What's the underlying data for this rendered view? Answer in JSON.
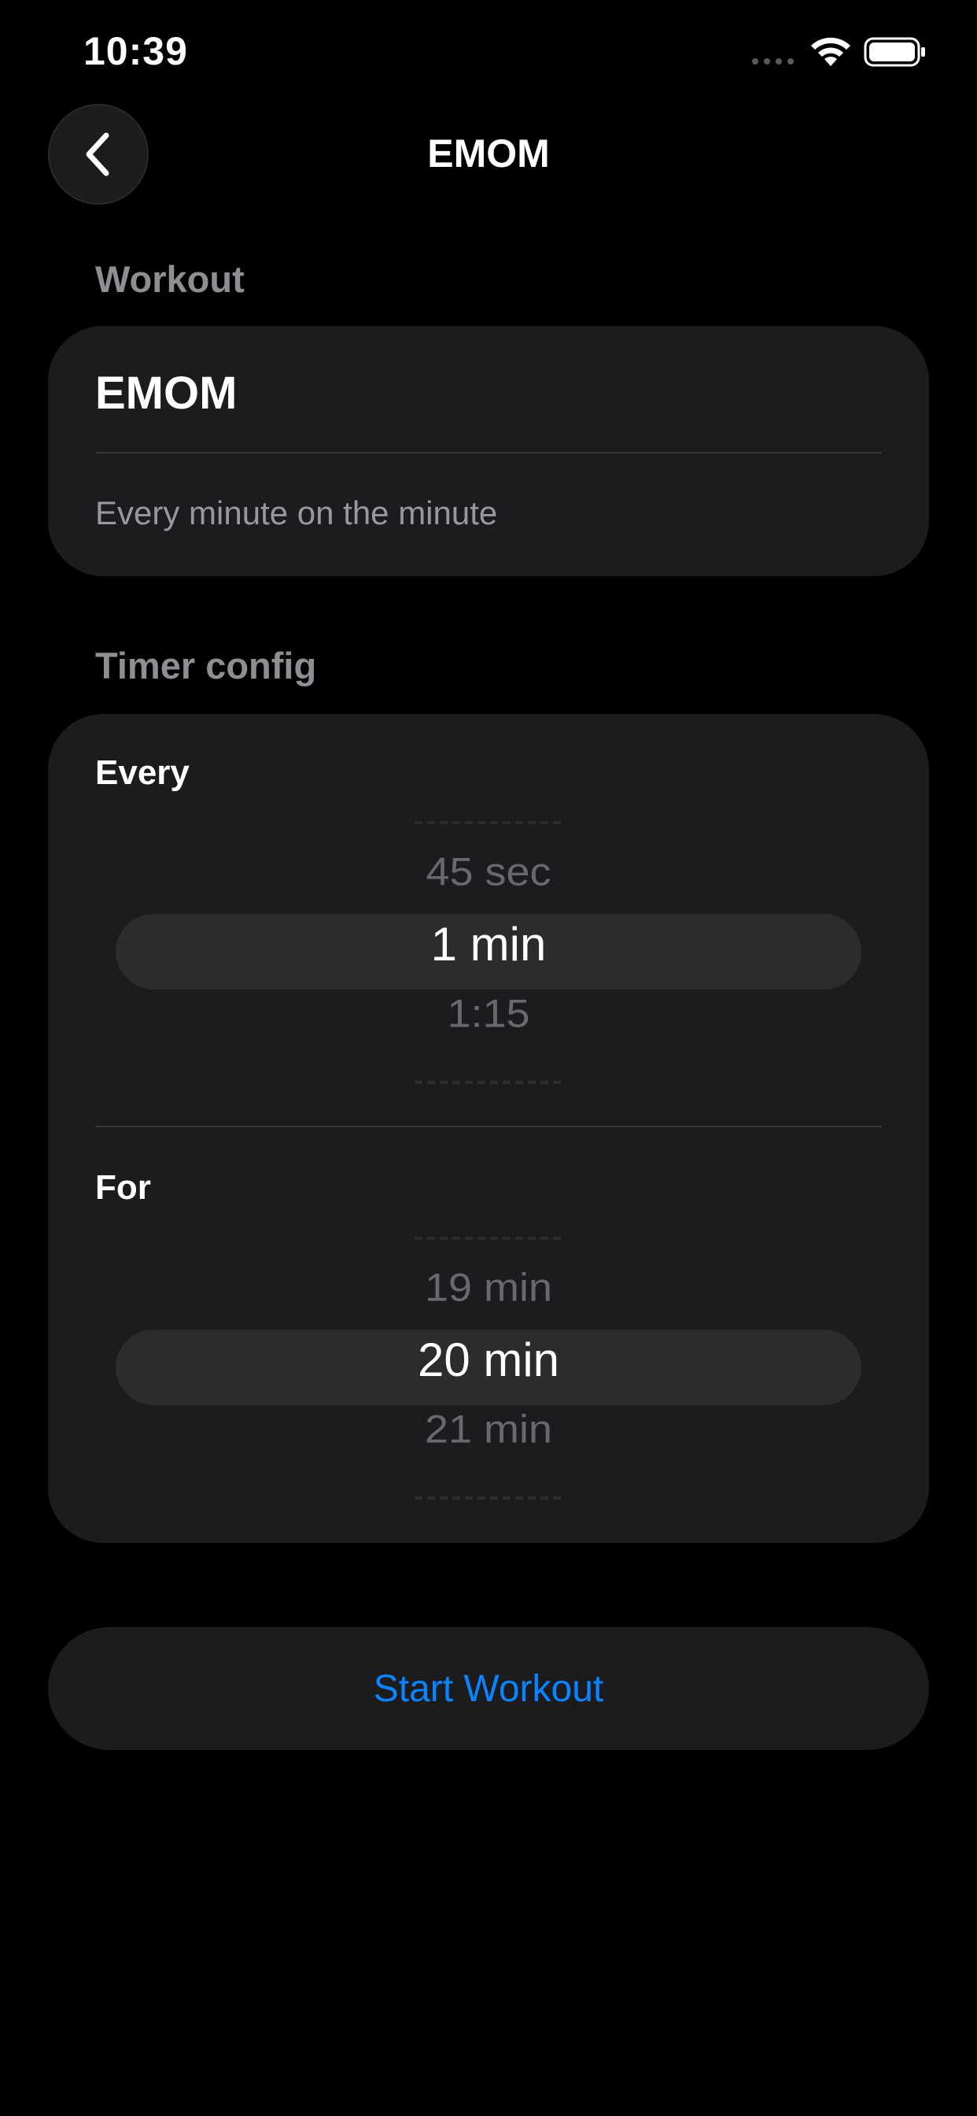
{
  "status_bar": {
    "time": "10:39",
    "icons": [
      "cellular-signal-icon",
      "wifi-icon",
      "battery-icon"
    ]
  },
  "nav": {
    "back_icon": "chevron-left-icon",
    "title": "EMOM"
  },
  "workout_section": {
    "header": "Workout",
    "name": "EMOM",
    "description": "Every minute on the minute"
  },
  "timer_section": {
    "header": "Timer config",
    "every": {
      "label": "Every",
      "prev": "45 sec",
      "selected": "1 min",
      "next": "1:15"
    },
    "for": {
      "label": "For",
      "prev": "19 min",
      "selected": "20 min",
      "next": "21 min"
    }
  },
  "start_button": {
    "label": "Start Workout"
  },
  "colors": {
    "background": "#000000",
    "card": "#1c1c1e",
    "picker_highlight": "#2c2c2e",
    "accent": "#0a84ff",
    "secondary_text": "#8e8e93"
  }
}
